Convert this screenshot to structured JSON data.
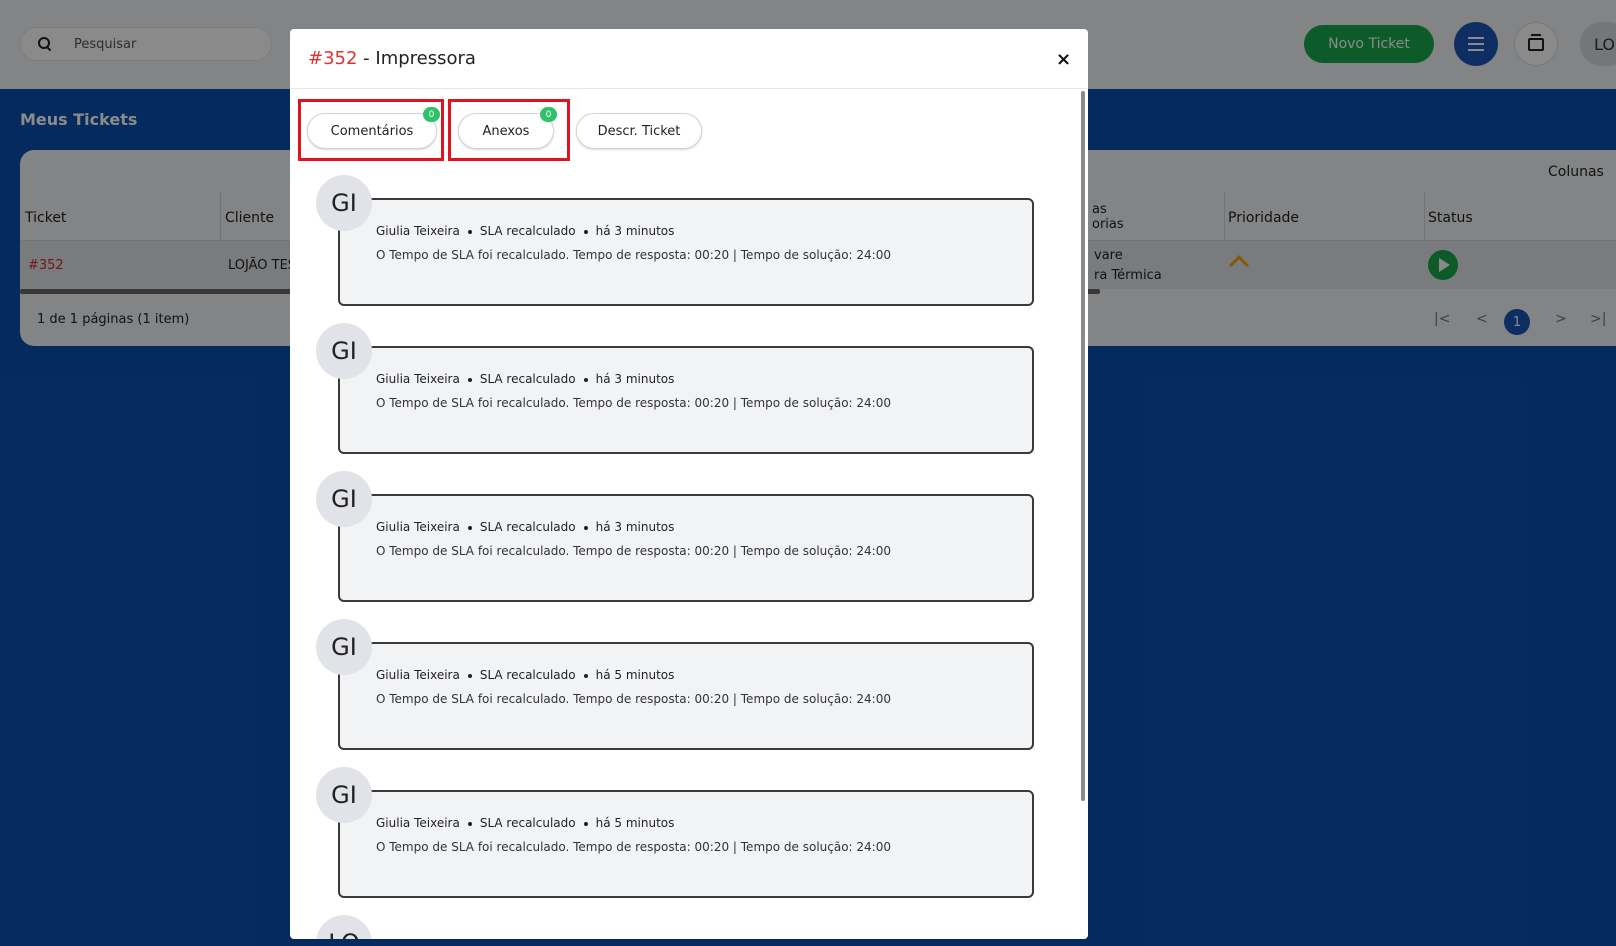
{
  "topbar": {
    "search_placeholder": "Pesquisar",
    "new_ticket_label": "Novo Ticket",
    "user_initials": "LO"
  },
  "page": {
    "title": "Meus Tickets",
    "columns_label": "Colunas",
    "headers": {
      "ticket": "Ticket",
      "cliente": "Cliente",
      "categorias_top": "as",
      "categorias_bottom": "orias",
      "prioridade": "Prioridade",
      "status": "Status"
    },
    "row": {
      "ticket": "#352",
      "cliente": "LOJÃO TES",
      "categoria_line1": "vare",
      "categoria_line2": "ra Térmica"
    },
    "pagination_info": "1 de 1 páginas (1 item)",
    "pager": {
      "first": "|<",
      "prev": "<",
      "current": "1",
      "next": ">",
      "last": ">|"
    }
  },
  "modal": {
    "ticket_number": "#352",
    "title_rest": " - Impressora",
    "close_label": "×",
    "tabs": [
      {
        "label": "Comentários",
        "badge": "0"
      },
      {
        "label": "Anexos",
        "badge": "0"
      },
      {
        "label": "Descr. Ticket"
      }
    ],
    "entries": [
      {
        "initials": "GI",
        "author": "Giulia Teixeira",
        "type": "SLA recalculado",
        "time": "há 3 minutos",
        "message": "O Tempo de SLA foi recalculado. Tempo de resposta: 00:20 | Tempo de solução: 24:00"
      },
      {
        "initials": "GI",
        "author": "Giulia Teixeira",
        "type": "SLA recalculado",
        "time": "há 3 minutos",
        "message": "O Tempo de SLA foi recalculado. Tempo de resposta: 00:20 | Tempo de solução: 24:00"
      },
      {
        "initials": "GI",
        "author": "Giulia Teixeira",
        "type": "SLA recalculado",
        "time": "há 3 minutos",
        "message": "O Tempo de SLA foi recalculado. Tempo de resposta: 00:20 | Tempo de solução: 24:00"
      },
      {
        "initials": "GI",
        "author": "Giulia Teixeira",
        "type": "SLA recalculado",
        "time": "há 5 minutos",
        "message": "O Tempo de SLA foi recalculado. Tempo de resposta: 00:20 | Tempo de solução: 24:00"
      },
      {
        "initials": "GI",
        "author": "Giulia Teixeira",
        "type": "SLA recalculado",
        "time": "há 5 minutos",
        "message": "O Tempo de SLA foi recalculado. Tempo de resposta: 00:20 | Tempo de solução: 24:00"
      }
    ],
    "partial_entry_initials": "LO"
  },
  "colors": {
    "brand_blue": "#0b4fae",
    "accent_green": "#18a84d",
    "ticket_red": "#e03131",
    "highlight_red": "#e0141e",
    "priority_orange": "#f2a30f"
  },
  "icons": [
    "search-icon",
    "menu-icon",
    "stack-icon",
    "close-icon",
    "play-icon",
    "chevron-up-icon"
  ]
}
